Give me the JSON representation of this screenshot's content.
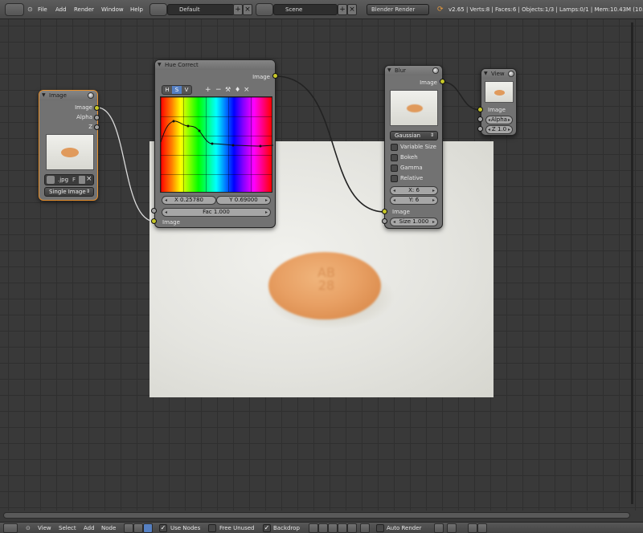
{
  "topbar": {
    "menus": [
      "File",
      "Add",
      "Render",
      "Window",
      "Help"
    ],
    "screen_layout": "Default",
    "scene": "Scene",
    "render_engine": "Blender Render",
    "stats": "v2.65 | Verts:8 | Faces:6 | Objects:1/3 | Lamps:0/1 | Mem:10.43M (10.6"
  },
  "nodes": {
    "image": {
      "title": "Image",
      "outputs": [
        "Image",
        "Alpha",
        "Z"
      ],
      "file_name": ".jpg",
      "file_f": "F",
      "source": "Single Image"
    },
    "hue": {
      "title": "Hue Correct",
      "output": "Image",
      "tabs": [
        "H",
        "S",
        "V"
      ],
      "tools": [
        "+",
        "−",
        "⚒",
        "♦",
        "×"
      ],
      "x_field": "X 0.25780",
      "y_field": "Y 0.69000",
      "fac": "Fac 1.000",
      "input": "Image"
    },
    "blur": {
      "title": "Blur",
      "output": "Image",
      "filter_type": "Gaussian",
      "options": [
        "Variable Size",
        "Bokeh",
        "Gamma",
        "Relative"
      ],
      "x": "X: 6",
      "y": "Y: 6",
      "input": "Image",
      "size": "Size 1.000"
    },
    "viewer": {
      "title": "View",
      "input": "Image",
      "alpha": "Alpha",
      "z": "Z 1.0"
    }
  },
  "statusbar": {
    "menus": [
      "View",
      "Select",
      "Add",
      "Node"
    ],
    "use_nodes": "Use Nodes",
    "free_unused": "Free Unused",
    "backdrop": "Backdrop",
    "auto_render": "Auto Render",
    "use_nodes_checked": "✓",
    "backdrop_checked": "✓"
  },
  "backdrop_pill_text": "AB\n28",
  "colors": {
    "socket_image": "#c7c729",
    "socket_value": "#a1a1a1",
    "node_body": "#727272",
    "grid_bg": "#393939",
    "selected_border": "#e6902e"
  }
}
